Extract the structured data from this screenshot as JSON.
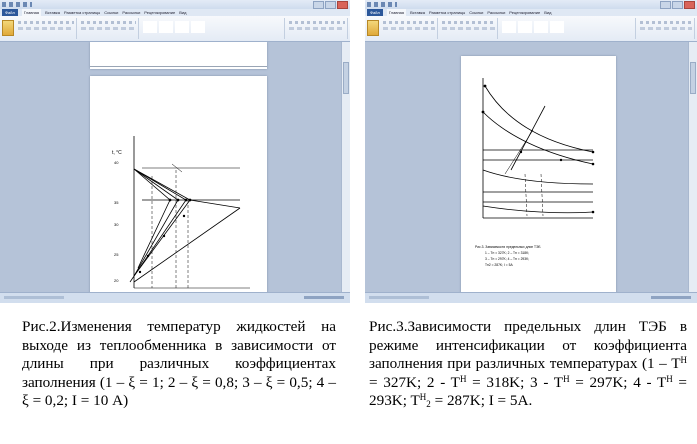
{
  "left_window": {
    "tabs": [
      "Файл",
      "Главная",
      "Вставка",
      "Разметка страницы",
      "Ссылки",
      "Рассылки",
      "Рецензирование",
      "Вид"
    ],
    "figure": {
      "axis_label_y": "t, °C",
      "tick_labels": [
        "40",
        "35",
        "30",
        "25",
        "20"
      ]
    }
  },
  "right_window": {
    "tabs": [
      "Файл",
      "Главная",
      "Вставка",
      "Разметка страницы",
      "Ссылки",
      "Рассылки",
      "Рецензирование",
      "Вид"
    ],
    "figure": {
      "legend_lines": [
        "Рис.3. Зависимости предельных длин ТЭБ",
        "1 – Tн = 327K; 2 – Tн = 318K;",
        "3 – Tн = 297K; 4 – Tн = 293K;",
        "Tн2 = 287K; I = 5A"
      ]
    }
  },
  "captions": {
    "left": {
      "text": "Рис.2.Изменения температур жидкостей на выходе из теплообменника в зависимости от длины при различных коэффициентах заполнения (1 – ξ = 1; 2 – ξ = 0,8; 3 – ξ = 0,5; 4 – ξ = 0,2; I = 10 А)"
    },
    "right": {
      "part1": "Рис.3.Зависимости предельных длин ТЭБ в режиме интенсификации от коэффициента заполнения при различных температурах (1 – T",
      "sup1": "Н",
      "part2": " = 327K; 2 - T",
      "sup2": "Н",
      "part3": " = 318K; 3 - T",
      "sup3": "Н",
      "part4": " = 297K; 4 - T",
      "sup4": "Н",
      "part5": " = 293K; T",
      "sup5": "Н",
      "sub5": "2",
      "part6": " = 287K; I = 5A."
    }
  }
}
